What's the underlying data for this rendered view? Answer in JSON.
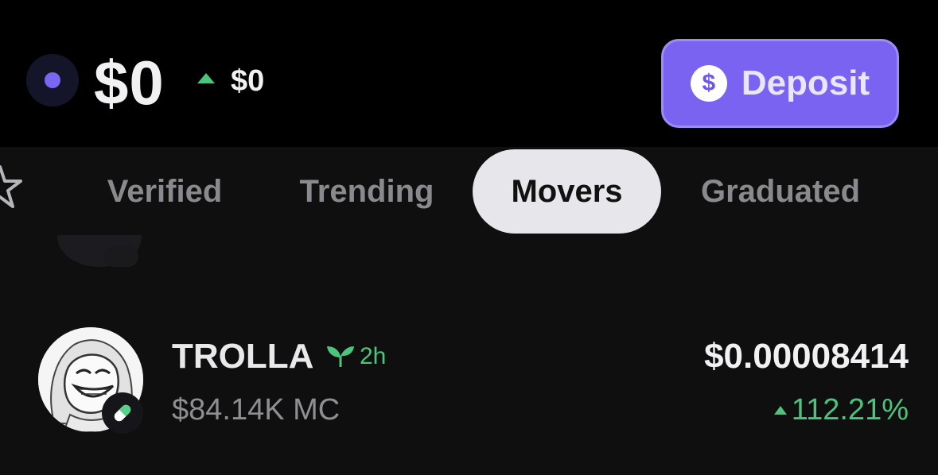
{
  "header": {
    "balance": "$0",
    "change": "$0",
    "deposit_label": "Deposit",
    "deposit_icon": "$"
  },
  "tabs": [
    {
      "label": "Verified",
      "active": false
    },
    {
      "label": "Trending",
      "active": false
    },
    {
      "label": "Movers",
      "active": true
    },
    {
      "label": "Graduated",
      "active": false
    }
  ],
  "tokens": [
    {
      "name": "TROLLA",
      "age": "2h",
      "market_cap": "$84.14K MC",
      "price": "$0.00008414",
      "change_pct": "112.21%"
    }
  ],
  "colors": {
    "accent": "#7a63f0",
    "positive": "#4cc47b",
    "background": "#0f0f10"
  },
  "icons": [
    "wallet-dot-icon",
    "up-arrow-icon",
    "dollar-icon",
    "star-icon",
    "leaf-icon",
    "pill-icon"
  ]
}
